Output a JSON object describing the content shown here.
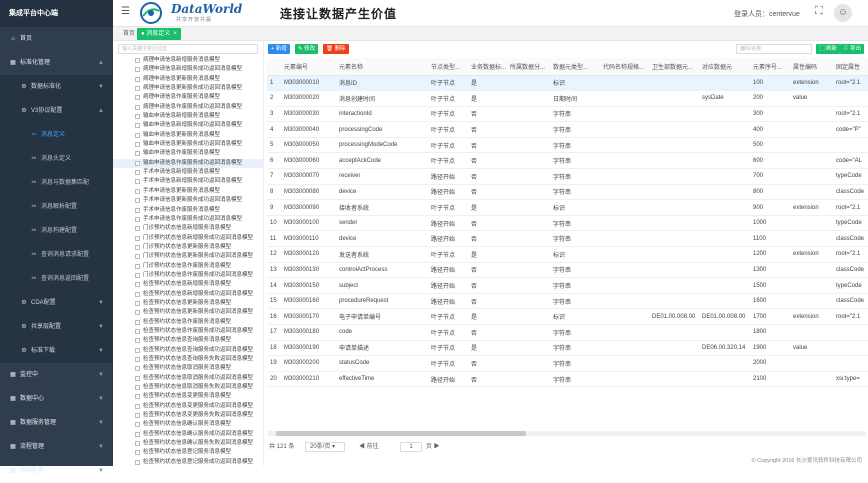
{
  "app": {
    "title": "集成平台中心端"
  },
  "header": {
    "logo_text": "DataWorld",
    "logo_sub": "共享开放共赢",
    "slogan": "连接让数据产生价值",
    "user_label": "登录人员：centervue"
  },
  "sidebar": {
    "items": [
      {
        "label": "首页",
        "icon": "home-icon",
        "level": 0
      },
      {
        "label": "标准化管理",
        "icon": "grid-icon",
        "level": 0,
        "arrow": "▲"
      },
      {
        "label": "数据标准化",
        "icon": "gear-icon",
        "level": 1,
        "arrow": "▼"
      },
      {
        "label": "V3协议配置",
        "icon": "gear-icon",
        "level": 1,
        "arrow": "▲"
      },
      {
        "label": "消息定义",
        "icon": "tool-icon",
        "level": 2,
        "active": true
      },
      {
        "label": "消息头定义",
        "icon": "tool-icon",
        "level": 2
      },
      {
        "label": "消息与数据集匹配",
        "icon": "tool-icon",
        "level": 2
      },
      {
        "label": "消息解析配置",
        "icon": "tool-icon",
        "level": 2
      },
      {
        "label": "消息构建配置",
        "icon": "tool-icon",
        "level": 2
      },
      {
        "label": "查询消息请求配置",
        "icon": "tool-icon",
        "level": 2
      },
      {
        "label": "查询消息返回配置",
        "icon": "tool-icon",
        "level": 2
      },
      {
        "label": "CDA配置",
        "icon": "gear-icon",
        "level": 1,
        "arrow": "▼"
      },
      {
        "label": "共享层配置",
        "icon": "gear-icon",
        "level": 1,
        "arrow": "▼"
      },
      {
        "label": "标准下载",
        "icon": "gear-icon",
        "level": 1,
        "arrow": "▼"
      },
      {
        "label": "监控中",
        "icon": "grid-icon",
        "level": 0,
        "arrow": "▼"
      },
      {
        "label": "数据中心",
        "icon": "grid-icon",
        "level": 0,
        "arrow": "▼"
      },
      {
        "label": "数据服务管理",
        "icon": "grid-icon",
        "level": 0,
        "arrow": "▼"
      },
      {
        "label": "流程管理",
        "icon": "grid-icon",
        "level": 0,
        "arrow": "▼"
      },
      {
        "label": "基础配置",
        "icon": "grid-icon",
        "level": 0,
        "arrow": "▼"
      }
    ]
  },
  "tabs": {
    "home": "首页",
    "active": "消息定义"
  },
  "tree": {
    "placeholder": "输入关键字进行过滤",
    "items": [
      "病理申请信息新增服务消息模型",
      "病理申请信息新增服务成功返回消息模型",
      "病理申请信息更新服务消息模型",
      "病理申请信息更新服务成功返回消息模型",
      "病理申请信息作废服务消息模型",
      "病理申请信息作废服务成功返回消息模型",
      "输血申请信息新增服务消息模型",
      "输血申请信息新增服务成功返回消息模型",
      "输血申请信息更新服务消息模型",
      "输血申请信息更新服务成功返回消息模型",
      "输血申请信息作废服务消息模型",
      "输血申请信息作废服务成功返回消息模型",
      "手术申请信息新增服务消息模型",
      "手术申请信息新增服务成功返回消息模型",
      "手术申请信息更新服务消息模型",
      "手术申请信息更新服务成功返回消息模型",
      "手术申请信息作废服务消息模型",
      "手术申请信息作废服务成功返回消息模型",
      "门诊预约状态信息新增服务消息模型",
      "门诊预约状态信息新增服务成功返回消息模型",
      "门诊预约状态信息更新服务消息模型",
      "门诊预约状态信息更新服务成功返回消息模型",
      "门诊预约状态信息作废服务消息模型",
      "门诊预约状态信息作废服务成功返回消息模型",
      "检查预约状态信息新增服务消息模型",
      "检查预约状态信息新增服务成功返回消息模型",
      "检查预约状态信息更新服务消息模型",
      "检查预约状态信息更新服务成功返回消息模型",
      "检查预约状态信息作废服务消息模型",
      "检查预约状态信息作废服务成功返回消息模型",
      "检查预约状态信息查询服务消息模型",
      "检查预约状态信息查询服务成功返回消息模型",
      "检查预约状态信息查询服务失败返回消息模型",
      "检查预约状态信息取消服务消息模型",
      "检查预约状态信息取消服务成功返回消息模型",
      "检查预约状态信息取消服务失败返回消息模型",
      "检查预约状态信息变更服务消息模型",
      "检查预约状态信息变更服务成功返回消息模型",
      "检查预约状态信息变更服务失败返回消息模型",
      "检查预约状态信息确认服务消息模型",
      "检查预约状态信息确认服务成功返回消息模型",
      "检查预约状态信息确认服务失败返回消息模型",
      "检查预约状态信息登记服务消息模型",
      "检查预约状态信息登记服务成功返回消息模型"
    ],
    "selected_index": 11
  },
  "toolbar": {
    "add": "+ 新增",
    "edit": "✎ 修改",
    "delete": "🗑 删除",
    "search_placeholder": "编码/名称",
    "search": "▢ 刷新",
    "export": "⇩ 导出"
  },
  "table": {
    "columns": [
      "",
      "元素编号",
      "元素名称",
      "节点类型...",
      "业务数据标...",
      "所属数据分...",
      "数据元类型...",
      "代码名称规格...",
      "卫生部数据元...",
      "对应数据元",
      "元素序号...",
      "属性编码",
      "固定属性"
    ],
    "rows": [
      [
        "1",
        "M303000010",
        "消息ID",
        "叶子节点",
        "是",
        "",
        "标识",
        "",
        "",
        "",
        "100",
        "extension",
        "root=\"2.1"
      ],
      [
        "2",
        "M303000020",
        "消息创建时间",
        "叶子节点",
        "是",
        "",
        "日期时间",
        "",
        "",
        "sysDate",
        "200",
        "value",
        ""
      ],
      [
        "3",
        "M303000030",
        "interactionId",
        "叶子节点",
        "否",
        "",
        "字符串",
        "",
        "",
        "",
        "300",
        "",
        "root=\"2.1"
      ],
      [
        "4",
        "M303000040",
        "processingCode",
        "叶子节点",
        "否",
        "",
        "字符串",
        "",
        "",
        "",
        "400",
        "",
        "code=\"P\""
      ],
      [
        "5",
        "M303000050",
        "processingModeCode",
        "叶子节点",
        "否",
        "",
        "字符串",
        "",
        "",
        "",
        "500",
        "",
        ""
      ],
      [
        "6",
        "M303000060",
        "acceptAckCode",
        "叶子节点",
        "否",
        "",
        "字符串",
        "",
        "",
        "",
        "600",
        "",
        "code=\"AL"
      ],
      [
        "7",
        "M303000070",
        "receiver",
        "路径开始",
        "否",
        "",
        "字符串",
        "",
        "",
        "",
        "700",
        "",
        "typeCode"
      ],
      [
        "8",
        "M303000080",
        "device",
        "路径开始",
        "否",
        "",
        "字符串",
        "",
        "",
        "",
        "800",
        "",
        "classCode"
      ],
      [
        "9",
        "M303000090",
        "接收者系统",
        "叶子节点",
        "是",
        "",
        "标识",
        "",
        "",
        "",
        "900",
        "extension",
        "root=\"2.1"
      ],
      [
        "10",
        "M303000100",
        "sender",
        "路径开始",
        "否",
        "",
        "字符串",
        "",
        "",
        "",
        "1000",
        "",
        "typeCode"
      ],
      [
        "11",
        "M303000110",
        "device",
        "路径开始",
        "否",
        "",
        "字符串",
        "",
        "",
        "",
        "1100",
        "",
        "classCode"
      ],
      [
        "12",
        "M303000120",
        "发送者系统",
        "叶子节点",
        "是",
        "",
        "标识",
        "",
        "",
        "",
        "1200",
        "extension",
        "root=\"2.1"
      ],
      [
        "13",
        "M303000130",
        "controlActProcess",
        "路径开始",
        "否",
        "",
        "字符串",
        "",
        "",
        "",
        "1300",
        "",
        "classCode"
      ],
      [
        "14",
        "M303000150",
        "subject",
        "路径开始",
        "否",
        "",
        "字符串",
        "",
        "",
        "",
        "1500",
        "",
        "typeCode"
      ],
      [
        "15",
        "M303000160",
        "procedureRequest",
        "路径开始",
        "否",
        "",
        "字符串",
        "",
        "",
        "",
        "1600",
        "",
        "classCode"
      ],
      [
        "16",
        "M303000170",
        "电子申请单编号",
        "叶子节点",
        "是",
        "",
        "标识",
        "",
        "DE01.00.008.00",
        "DE01.00.008.00",
        "1700",
        "extension",
        "root=\"2.1"
      ],
      [
        "17",
        "M303000180",
        "code",
        "叶子节点",
        "否",
        "",
        "字符串",
        "",
        "",
        "",
        "1800",
        "",
        ""
      ],
      [
        "18",
        "M303000190",
        "申请单描述",
        "叶子节点",
        "是",
        "",
        "字符串",
        "",
        "",
        "DE06.00.320.14",
        "1900",
        "value",
        ""
      ],
      [
        "19",
        "M303000200",
        "statusCode",
        "叶子节点",
        "否",
        "",
        "字符串",
        "",
        "",
        "",
        "2000",
        "",
        ""
      ],
      [
        "20",
        "M303000210",
        "effectiveTime",
        "路径开始",
        "否",
        "",
        "字符串",
        "",
        "",
        "",
        "2100",
        "",
        "xsi:type="
      ]
    ],
    "highlight_row": 0
  },
  "pagination": {
    "total": "共 121 条",
    "page_size": "20条/页",
    "prev": "◀  前往",
    "page": "1",
    "next": "页  ▶"
  },
  "footer": "© Copyright 2016 长沙爱讯软件科技有限公司"
}
